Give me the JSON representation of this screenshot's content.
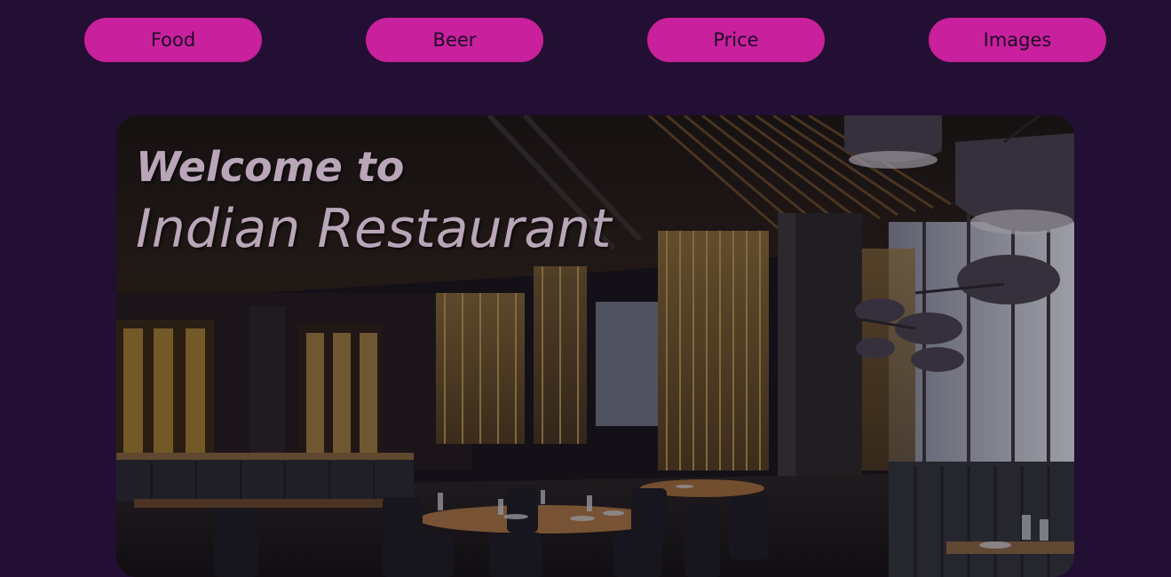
{
  "nav": {
    "items": [
      {
        "label": "Food"
      },
      {
        "label": "Beer"
      },
      {
        "label": "Price"
      },
      {
        "label": "Images"
      }
    ]
  },
  "hero": {
    "welcome": "Welcome to",
    "name": "Indian Restaurant"
  },
  "colors": {
    "background": "#220f33",
    "nav_button": "#c9209d",
    "nav_text": "#1a0a26",
    "hero_text": "#b9a6b8"
  }
}
